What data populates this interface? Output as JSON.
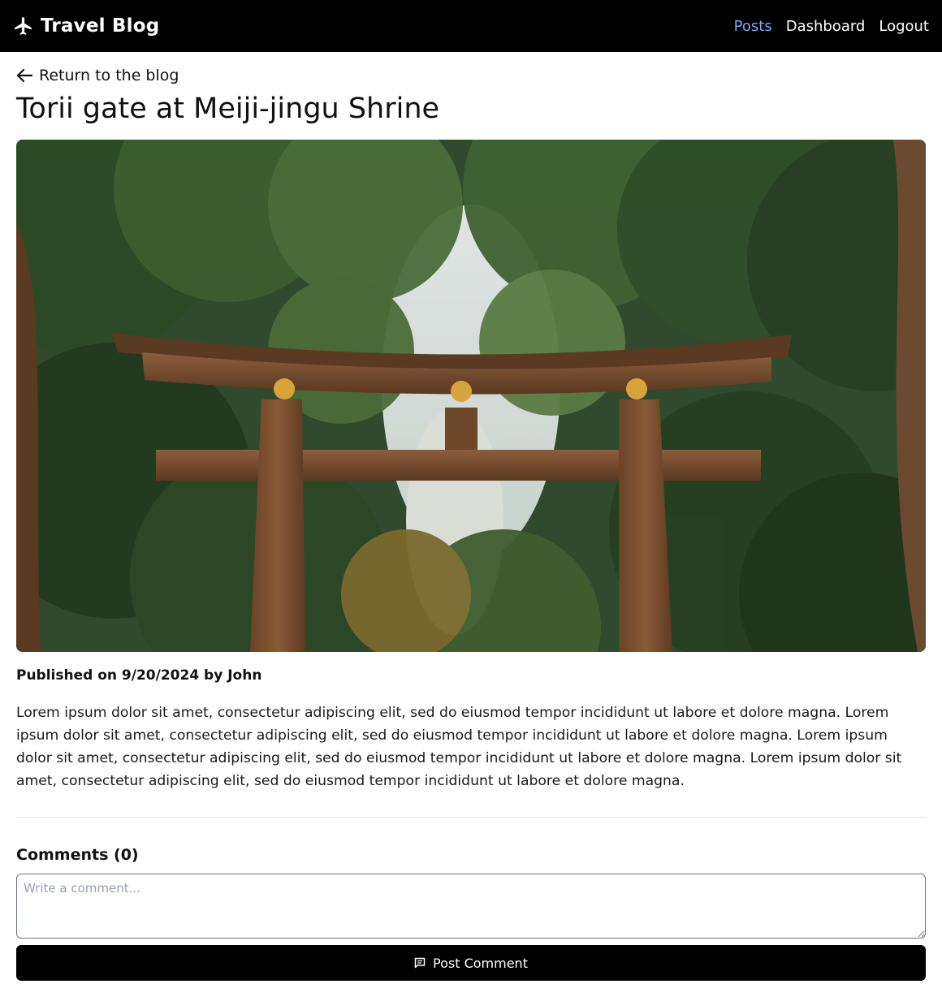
{
  "navbar": {
    "brand_icon": "airplane-icon",
    "brand": "Travel Blog",
    "links": [
      {
        "label": "Posts",
        "active": true
      },
      {
        "label": "Dashboard",
        "active": false
      },
      {
        "label": "Logout",
        "active": false
      }
    ],
    "active_color": "#7aa7f5"
  },
  "post": {
    "back_icon": "arrow-left-icon",
    "back_label": "Return to the blog",
    "title": "Torii gate at Meiji-jingu Shrine",
    "meta": "Published on 9/20/2024 by John",
    "body": "Lorem ipsum dolor sit amet, consectetur adipiscing elit, sed do eiusmod tempor incididunt ut labore et dolore magna. Lorem ipsum dolor sit amet, consectetur adipiscing elit, sed do eiusmod tempor incididunt ut labore et dolore magna. Lorem ipsum dolor sit amet, consectetur adipiscing elit, sed do eiusmod tempor incididunt ut labore et dolore magna. Lorem ipsum dolor sit amet, consectetur adipiscing elit, sed do eiusmod tempor incididunt ut labore et dolore magna."
  },
  "comments": {
    "title": "Comments (0)",
    "placeholder": "Write a comment...",
    "value": "",
    "button_icon": "comment-icon",
    "button_label": "Post Comment"
  }
}
